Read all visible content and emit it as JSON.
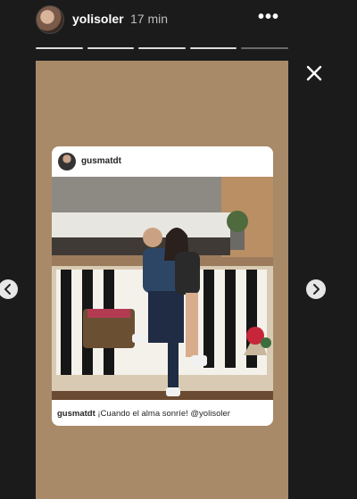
{
  "header": {
    "username": "yolisoler",
    "timestamp": "17 min",
    "more_icon": "more-options-icon",
    "close_icon": "close-icon"
  },
  "progress": {
    "segments": 5,
    "active_fraction": 0.8
  },
  "shared_post": {
    "username": "gusmatdt",
    "caption_user": "gusmatdt",
    "caption_text": "¡Cuando el alma sonríe! @yolisoler"
  },
  "nav": {
    "prev_icon": "chevron-left-icon",
    "next_icon": "chevron-right-icon"
  },
  "colors": {
    "background": "#1b1b1b",
    "story_bg": "#a88a69",
    "card_bg": "#ffffff"
  }
}
